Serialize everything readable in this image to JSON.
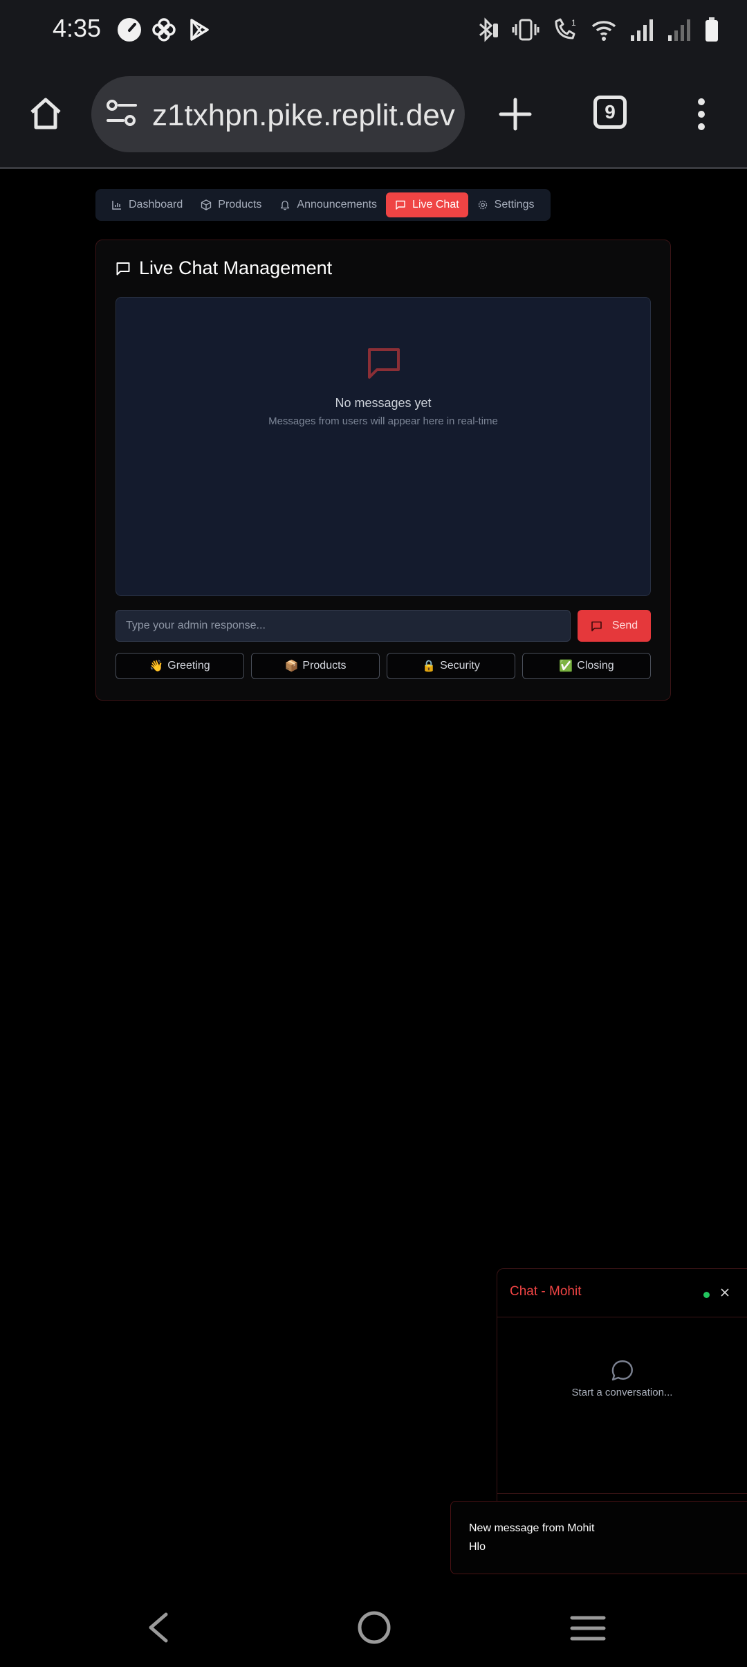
{
  "status_bar": {
    "time": "4:35"
  },
  "browser": {
    "url": "z1txhpn.pike.replit.dev",
    "tab_count": "9"
  },
  "nav": {
    "tabs": [
      {
        "label": "Dashboard",
        "icon": "bar-chart-icon"
      },
      {
        "label": "Products",
        "icon": "package-icon"
      },
      {
        "label": "Announcements",
        "icon": "bell-icon"
      },
      {
        "label": "Live Chat",
        "icon": "message-square-icon",
        "active": true
      },
      {
        "label": "Settings",
        "icon": "gear-icon"
      }
    ]
  },
  "card": {
    "title": "Live Chat Management",
    "empty_title": "No messages yet",
    "empty_subtitle": "Messages from users will appear here in real-time",
    "input_placeholder": "Type your admin response...",
    "send_label": "Send",
    "quick_replies": [
      {
        "emoji": "👋",
        "label": "Greeting"
      },
      {
        "emoji": "📦",
        "label": "Products"
      },
      {
        "emoji": "🔒",
        "label": "Security"
      },
      {
        "emoji": "✅",
        "label": "Closing"
      }
    ]
  },
  "chat_widget": {
    "title": "Chat - Mohit",
    "empty_text": "Start a conversation..."
  },
  "toast": {
    "title": "New message from Mohit",
    "body": "Hlo"
  },
  "colors": {
    "accent": "#ef4444",
    "online": "#22c55e",
    "panel": "#141b2d"
  }
}
